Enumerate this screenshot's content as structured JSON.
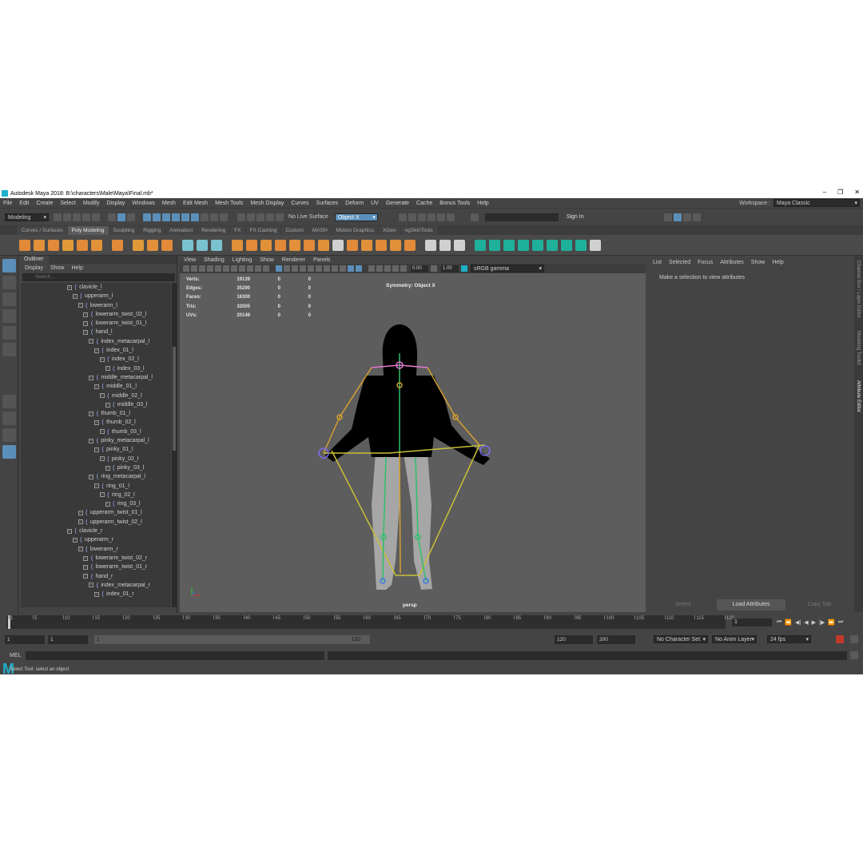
{
  "window": {
    "title": "Autodesk Maya 2018: B:\\characters\\Male\\Maya\\Final.mb*",
    "minimize": "–",
    "maximize": "❐",
    "close": "✕"
  },
  "menubar": [
    "File",
    "Edit",
    "Create",
    "Select",
    "Modify",
    "Display",
    "Windows",
    "Mesh",
    "Edit Mesh",
    "Mesh Tools",
    "Mesh Display",
    "Curves",
    "Surfaces",
    "Deform",
    "UV",
    "Generate",
    "Cache",
    "Bonus Tools",
    "Help"
  ],
  "workspace": {
    "label": "Workspace :",
    "value": "Maya Classic"
  },
  "statusline": {
    "mode": "Modeling",
    "live_surface": "No Live Surface",
    "symmetry": "Object X",
    "sign_in": "Sign In"
  },
  "shelf_tabs": [
    "Curves / Surfaces",
    "Poly Modeling",
    "Sculpting",
    "Rigging",
    "Animation",
    "Rendering",
    "FX",
    "FX Caching",
    "Custom",
    "MASH",
    "Motion Graphics",
    "XGen",
    "ngSkinTools"
  ],
  "shelf_active": "Poly Modeling",
  "outliner": {
    "tab": "Outliner",
    "menu": [
      "Display",
      "Show",
      "Help"
    ],
    "search_placeholder": "Search...",
    "items": [
      {
        "label": "clavicle_l",
        "depth": 0
      },
      {
        "label": "upperarm_l",
        "depth": 1
      },
      {
        "label": "lowerarm_l",
        "depth": 2
      },
      {
        "label": "lowerarm_twist_02_l",
        "depth": 3
      },
      {
        "label": "lowerarm_twist_01_l",
        "depth": 3
      },
      {
        "label": "hand_l",
        "depth": 3
      },
      {
        "label": "index_metacarpal_l",
        "depth": 4
      },
      {
        "label": "index_01_l",
        "depth": 5
      },
      {
        "label": "index_02_l",
        "depth": 6
      },
      {
        "label": "index_03_l",
        "depth": 7
      },
      {
        "label": "middle_metacarpal_l",
        "depth": 4
      },
      {
        "label": "middle_01_l",
        "depth": 5
      },
      {
        "label": "middle_02_l",
        "depth": 6
      },
      {
        "label": "middle_03_l",
        "depth": 7
      },
      {
        "label": "thumb_01_l",
        "depth": 4
      },
      {
        "label": "thumb_02_l",
        "depth": 5
      },
      {
        "label": "thumb_03_l",
        "depth": 6
      },
      {
        "label": "pinky_metacarpal_l",
        "depth": 4
      },
      {
        "label": "pinky_01_l",
        "depth": 5
      },
      {
        "label": "pinky_02_l",
        "depth": 6
      },
      {
        "label": "pinky_03_l",
        "depth": 7
      },
      {
        "label": "ring_metacarpal_l",
        "depth": 4
      },
      {
        "label": "ring_01_l",
        "depth": 5
      },
      {
        "label": "ring_02_l",
        "depth": 6
      },
      {
        "label": "ring_03_l",
        "depth": 7
      },
      {
        "label": "upperarm_twist_01_l",
        "depth": 2
      },
      {
        "label": "upperarm_twist_02_l",
        "depth": 2
      },
      {
        "label": "clavicle_r",
        "depth": 0
      },
      {
        "label": "upperarm_r",
        "depth": 1
      },
      {
        "label": "lowerarm_r",
        "depth": 2
      },
      {
        "label": "lowerarm_twist_02_r",
        "depth": 3
      },
      {
        "label": "lowerarm_twist_01_r",
        "depth": 3
      },
      {
        "label": "hand_r",
        "depth": 3
      },
      {
        "label": "index_metacarpal_r",
        "depth": 4
      },
      {
        "label": "index_01_r",
        "depth": 5
      }
    ]
  },
  "viewport": {
    "menu": [
      "View",
      "Shading",
      "Lighting",
      "Show",
      "Renderer",
      "Panels"
    ],
    "exposure": "0.00",
    "gamma": "1.00",
    "color_space": "sRGB gamma",
    "hud": [
      {
        "label": "Verts:",
        "value": "19139",
        "a": "0",
        "b": "0"
      },
      {
        "label": "Edges:",
        "value": "35290",
        "a": "0",
        "b": "0"
      },
      {
        "label": "Faces:",
        "value": "16300",
        "a": "0",
        "b": "0"
      },
      {
        "label": "Tris:",
        "value": "32005",
        "a": "0",
        "b": "0"
      },
      {
        "label": "UVs:",
        "value": "20149",
        "a": "0",
        "b": "0"
      }
    ],
    "symmetry_label": "Symmetry: Object X",
    "camera": "persp"
  },
  "attribute_editor": {
    "menu": [
      "List",
      "Selected",
      "Focus",
      "Attributes",
      "Show",
      "Help"
    ],
    "message": "Make a selection to view attributes",
    "buttons": [
      "Select",
      "Load Attributes",
      "Copy Tab"
    ],
    "side_tabs": [
      "Channel Box / Layer Editor",
      "Modeling Toolkit",
      "Attribute Editor"
    ]
  },
  "timeline": {
    "ticks": [
      "1",
      "5",
      "10",
      "15",
      "20",
      "25",
      "30",
      "35",
      "40",
      "45",
      "50",
      "55",
      "60",
      "65",
      "70",
      "75",
      "80",
      "85",
      "90",
      "95",
      "100",
      "105",
      "110",
      "115",
      "120"
    ],
    "current_frame": "1"
  },
  "range": {
    "start": "1",
    "anim_start": "1",
    "slider_start": "1",
    "slider_end": "120",
    "end": "120",
    "anim_end": "200",
    "character_set": "No Character Set",
    "anim_layer": "No Anim Layer",
    "fps": "24 fps"
  },
  "command": {
    "label": "MEL"
  },
  "help_line": "Select Tool: select an object",
  "colors": {
    "accent": "#5b8fb9",
    "maya_teal": "#1fb0c8",
    "viewport_bg": "#5d5d5d"
  }
}
